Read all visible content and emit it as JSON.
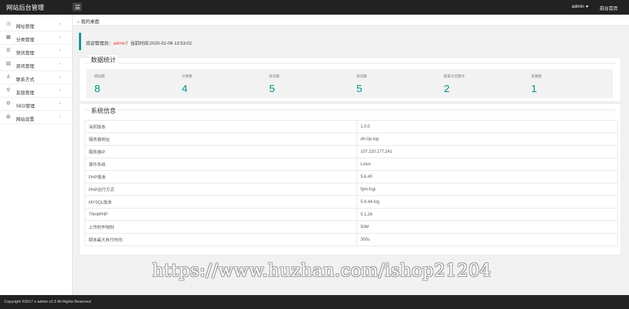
{
  "header": {
    "brand": "网站后台管理",
    "user": "admin",
    "front_link": "前台首页"
  },
  "sidebar": {
    "items": [
      {
        "label": "网址管理",
        "icon": "clock-icon"
      },
      {
        "label": "分类管理",
        "icon": "grid-icon"
      },
      {
        "label": "快讯管理",
        "icon": "list-icon"
      },
      {
        "label": "资讯管理",
        "icon": "article-icon"
      },
      {
        "label": "联系方式",
        "icon": "user-icon"
      },
      {
        "label": "友链管理",
        "icon": "link-icon"
      },
      {
        "label": "SEO管理",
        "icon": "gear-icon"
      },
      {
        "label": "网站设置",
        "icon": "globe-icon"
      }
    ]
  },
  "tabs": {
    "home": "我的桌面"
  },
  "welcome": {
    "prefix": "欢迎管理员：",
    "username": "admin",
    "suffix": "！当前时间:2020-01-06 13:53:02"
  },
  "stats": {
    "title": "数据统计",
    "items": [
      {
        "name": "网站数",
        "value": "8"
      },
      {
        "name": "分类数",
        "value": "4"
      },
      {
        "name": "快讯数",
        "value": "5"
      },
      {
        "name": "资讯数",
        "value": "5"
      },
      {
        "name": "联系方式数字",
        "value": "2"
      },
      {
        "name": "友链数",
        "value": "1"
      }
    ]
  },
  "system": {
    "title": "系统信息",
    "rows": [
      {
        "key": "当前版本",
        "value": "1.0.0"
      },
      {
        "key": "服务器地址",
        "value": "dh.0jx.top"
      },
      {
        "key": "服务器IP",
        "value": "107.220.177.241"
      },
      {
        "key": "操作系统",
        "value": "Linux"
      },
      {
        "key": "PHP版本",
        "value": "5.6.40"
      },
      {
        "key": "PHP运行方式",
        "value": "fpm-fcgi"
      },
      {
        "key": "MYSQL版本",
        "value": "5.6.44-log"
      },
      {
        "key": "ThinkPHP",
        "value": "5.1.26"
      },
      {
        "key": "上传附件限制",
        "value": "50M"
      },
      {
        "key": "脚本最大执行时间",
        "value": "300s"
      }
    ]
  },
  "watermark": "https://www.huzhan.com/ishop21204",
  "footer": {
    "copyright": "Copyright ©2017 x-admin v2.3 All Rights Reserved"
  },
  "colors": {
    "accent": "#009688",
    "topbar": "#222222",
    "username": "#ee3333"
  }
}
